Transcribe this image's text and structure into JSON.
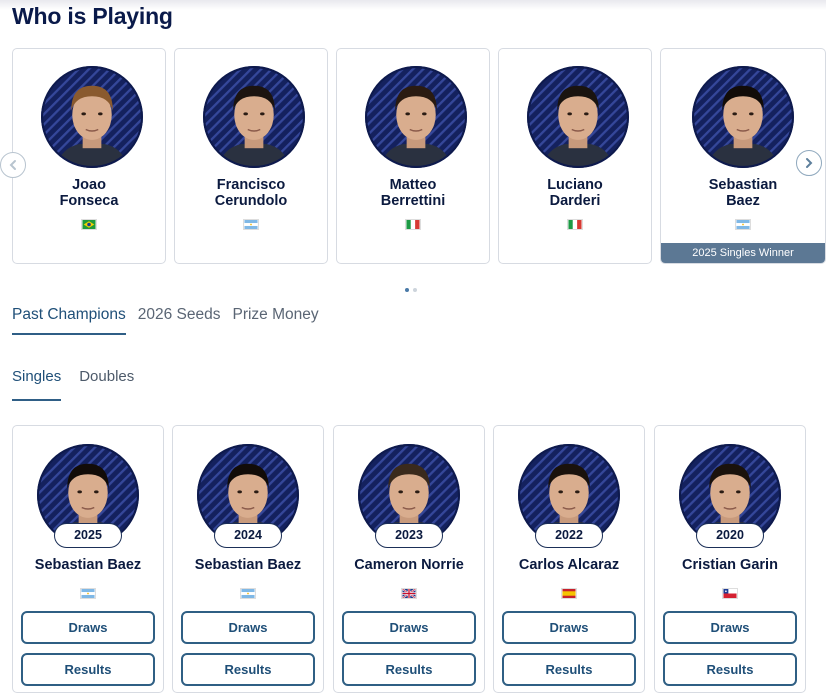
{
  "title": "Who is Playing",
  "players": [
    {
      "first": "Joao",
      "last": "Fonseca",
      "flag": "brazil",
      "hair": "#8a5a2e",
      "banner": ""
    },
    {
      "first": "Francisco",
      "last": "Cerundolo",
      "flag": "argentina",
      "hair": "#1c1410",
      "banner": ""
    },
    {
      "first": "Matteo",
      "last": "Berrettini",
      "flag": "italy",
      "hair": "#2a1b12",
      "banner": ""
    },
    {
      "first": "Luciano",
      "last": "Darderi",
      "flag": "italy",
      "hair": "#1a1410",
      "banner": ""
    },
    {
      "first": "Sebastian",
      "last": "Baez",
      "flag": "argentina",
      "hair": "#120c08",
      "banner": "2025 Singles Winner"
    }
  ],
  "carousel_dots": 2,
  "main_tabs": [
    "Past Champions",
    "2026 Seeds",
    "Prize Money"
  ],
  "sub_tabs": [
    "Singles",
    "Doubles"
  ],
  "champions": [
    {
      "year": "2025",
      "name": "Sebastian Baez",
      "flag": "argentina",
      "hair": "#120c08"
    },
    {
      "year": "2024",
      "name": "Sebastian Baez",
      "flag": "argentina",
      "hair": "#120c08"
    },
    {
      "year": "2023",
      "name": "Cameron Norrie",
      "flag": "uk",
      "hair": "#3a2a1c"
    },
    {
      "year": "2022",
      "name": "Carlos Alcaraz",
      "flag": "spain",
      "hair": "#1a120c"
    },
    {
      "year": "2020",
      "name": "Cristian Garin",
      "flag": "chile",
      "hair": "#1a120c"
    }
  ],
  "buttons": {
    "draws": "Draws",
    "results": "Results"
  },
  "colors": {
    "navy": "#0b1a3f",
    "avatar_bg": "#14215e",
    "accent": "#2f5e86",
    "banner": "#5c7894"
  },
  "icons": {
    "prev": "chevron-left-icon",
    "next": "chevron-right-icon"
  }
}
